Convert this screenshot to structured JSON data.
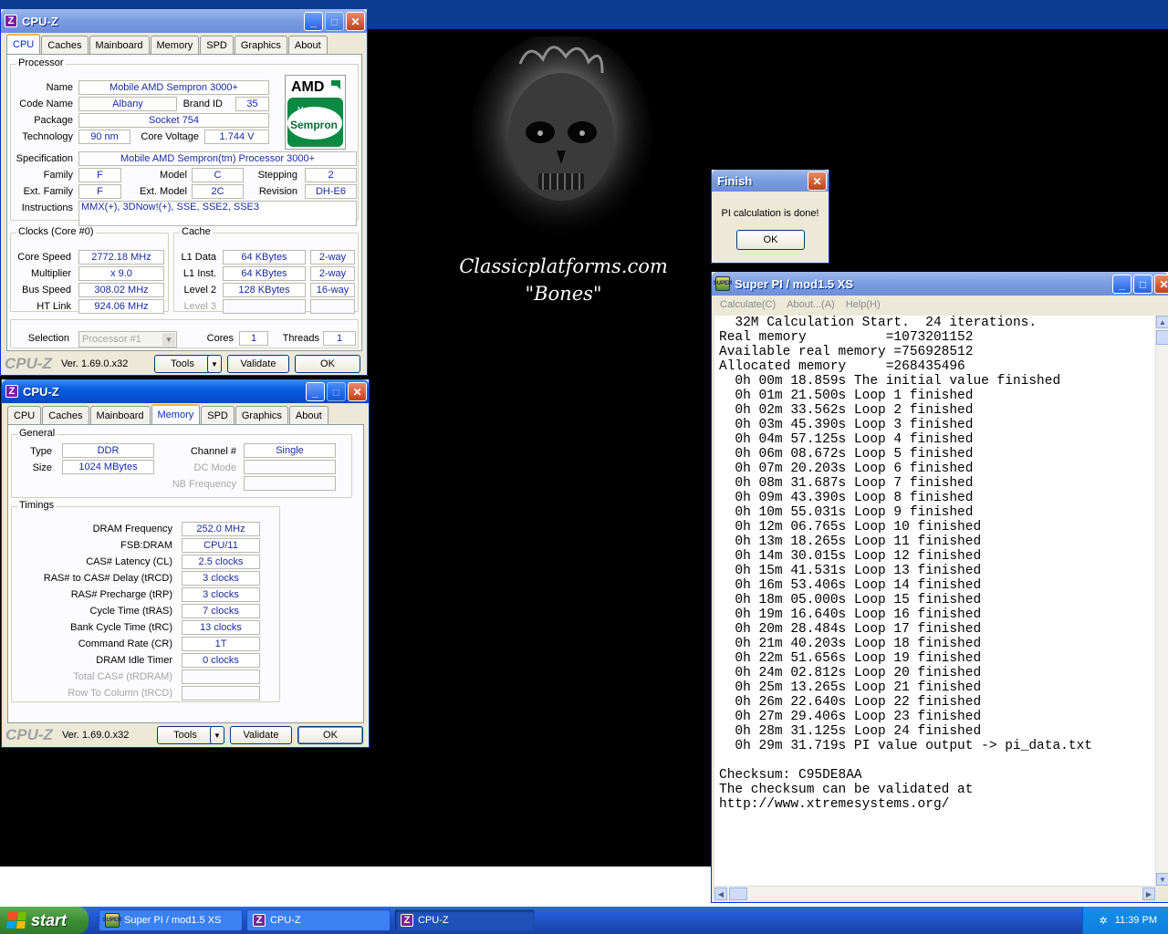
{
  "cpuz1": {
    "title": "CPU-Z",
    "tabs": [
      "CPU",
      "Caches",
      "Mainboard",
      "Memory",
      "SPD",
      "Graphics",
      "About"
    ],
    "processor": {
      "group": "Processor",
      "name_lbl": "Name",
      "name": "Mobile AMD Sempron 3000+",
      "code_lbl": "Code Name",
      "code": "Albany",
      "brand_lbl": "Brand ID",
      "brand": "35",
      "package_lbl": "Package",
      "package": "Socket 754",
      "tech_lbl": "Technology",
      "tech": "90 nm",
      "volt_lbl": "Core Voltage",
      "volt": "1.744 V",
      "spec_lbl": "Specification",
      "spec": "Mobile AMD Sempron(tm) Processor 3000+",
      "family_lbl": "Family",
      "family": "F",
      "model_lbl": "Model",
      "model": "C",
      "stepping_lbl": "Stepping",
      "stepping": "2",
      "extfam_lbl": "Ext. Family",
      "extfam": "F",
      "extmod_lbl": "Ext. Model",
      "extmod": "2C",
      "rev_lbl": "Revision",
      "rev": "DH-E6",
      "instr_lbl": "Instructions",
      "instr": "MMX(+), 3DNow!(+), SSE, SSE2, SSE3"
    },
    "logo": {
      "top": "AMD",
      "mid": "Mobile",
      "bottom": "Sempron",
      "color": "#008a3e"
    },
    "clocks": {
      "group": "Clocks (Core #0)",
      "speed_lbl": "Core Speed",
      "speed": "2772.18 MHz",
      "mult_lbl": "Multiplier",
      "mult": "x 9.0",
      "bus_lbl": "Bus Speed",
      "bus": "308.02 MHz",
      "ht_lbl": "HT Link",
      "ht": "924.06 MHz"
    },
    "cache": {
      "group": "Cache",
      "l1d_lbl": "L1 Data",
      "l1d": "64 KBytes",
      "l1d_w": "2-way",
      "l1i_lbl": "L1 Inst.",
      "l1i": "64 KBytes",
      "l1i_w": "2-way",
      "l2_lbl": "Level 2",
      "l2": "128 KBytes",
      "l2_w": "16-way",
      "l3_lbl": "Level 3"
    },
    "selection_lbl": "Selection",
    "selection": "Processor #1",
    "cores_lbl": "Cores",
    "cores": "1",
    "threads_lbl": "Threads",
    "threads": "1",
    "footer": {
      "brand": "CPU-Z",
      "version": "Ver. 1.69.0.x32",
      "tools": "Tools",
      "validate": "Validate",
      "ok": "OK"
    }
  },
  "cpuz2": {
    "title": "CPU-Z",
    "tabs": [
      "CPU",
      "Caches",
      "Mainboard",
      "Memory",
      "SPD",
      "Graphics",
      "About"
    ],
    "general": {
      "group": "General",
      "type_lbl": "Type",
      "type": "DDR",
      "size_lbl": "Size",
      "size": "1024 MBytes",
      "channel_lbl": "Channel #",
      "channel": "Single",
      "dc_lbl": "DC Mode",
      "nb_lbl": "NB Frequency"
    },
    "timings": {
      "group": "Timings",
      "rows": [
        {
          "label": "DRAM Frequency",
          "value": "252.0 MHz"
        },
        {
          "label": "FSB:DRAM",
          "value": "CPU/11"
        },
        {
          "label": "CAS# Latency (CL)",
          "value": "2.5 clocks"
        },
        {
          "label": "RAS# to CAS# Delay (tRCD)",
          "value": "3 clocks"
        },
        {
          "label": "RAS# Precharge (tRP)",
          "value": "3 clocks"
        },
        {
          "label": "Cycle Time (tRAS)",
          "value": "7 clocks"
        },
        {
          "label": "Bank Cycle Time (tRC)",
          "value": "13 clocks"
        },
        {
          "label": "Command Rate (CR)",
          "value": "1T"
        },
        {
          "label": "DRAM Idle Timer",
          "value": "0 clocks"
        },
        {
          "label": "Total CAS# (tRDRAM)",
          "value": ""
        },
        {
          "label": "Row To Column (tRCD)",
          "value": ""
        }
      ]
    },
    "footer": {
      "brand": "CPU-Z",
      "version": "Ver. 1.69.0.x32",
      "tools": "Tools",
      "validate": "Validate",
      "ok": "OK"
    }
  },
  "wallpaper": {
    "line1": "Classicplatforms.com",
    "line2": "\"Bones\""
  },
  "finish": {
    "title": "Finish",
    "message": "PI calculation is done!",
    "ok": "OK"
  },
  "superpi": {
    "title": "Super PI / mod1.5 XS",
    "menu": [
      "Calculate(C)",
      "About...(A)",
      "Help(H)"
    ],
    "lines": [
      "  32M Calculation Start.  24 iterations.",
      "Real memory          =1073201152",
      "Available real memory =756928512",
      "Allocated memory     =268435496",
      "  0h 00m 18.859s The initial value finished",
      "  0h 01m 21.500s Loop 1 finished",
      "  0h 02m 33.562s Loop 2 finished",
      "  0h 03m 45.390s Loop 3 finished",
      "  0h 04m 57.125s Loop 4 finished",
      "  0h 06m 08.672s Loop 5 finished",
      "  0h 07m 20.203s Loop 6 finished",
      "  0h 08m 31.687s Loop 7 finished",
      "  0h 09m 43.390s Loop 8 finished",
      "  0h 10m 55.031s Loop 9 finished",
      "  0h 12m 06.765s Loop 10 finished",
      "  0h 13m 18.265s Loop 11 finished",
      "  0h 14m 30.015s Loop 12 finished",
      "  0h 15m 41.531s Loop 13 finished",
      "  0h 16m 53.406s Loop 14 finished",
      "  0h 18m 05.000s Loop 15 finished",
      "  0h 19m 16.640s Loop 16 finished",
      "  0h 20m 28.484s Loop 17 finished",
      "  0h 21m 40.203s Loop 18 finished",
      "  0h 22m 51.656s Loop 19 finished",
      "  0h 24m 02.812s Loop 20 finished",
      "  0h 25m 13.265s Loop 21 finished",
      "  0h 26m 22.640s Loop 22 finished",
      "  0h 27m 29.406s Loop 23 finished",
      "  0h 28m 31.125s Loop 24 finished",
      "  0h 29m 31.719s PI value output -> pi_data.txt",
      "",
      "Checksum: C95DE8AA",
      "The checksum can be validated at",
      "http://www.xtremesystems.org/"
    ]
  },
  "taskbar": {
    "start": "start",
    "tasks": [
      "Super PI / mod1.5 XS",
      "CPU-Z",
      "CPU-Z"
    ],
    "clock": "11:39 PM"
  }
}
